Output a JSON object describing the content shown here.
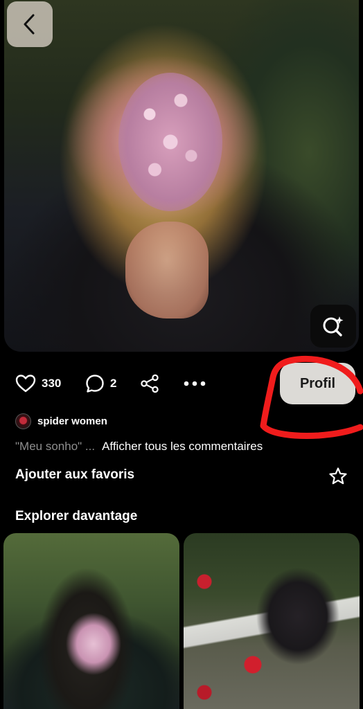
{
  "header": {
    "back_icon": "chevron-left-icon",
    "lens_icon": "visual-search-icon"
  },
  "actions": {
    "likes_count": "330",
    "comments_count": "2",
    "like_icon": "heart-icon",
    "comment_icon": "comment-icon",
    "share_icon": "share-icon",
    "more_icon": "more-icon"
  },
  "profile_button": {
    "label": "Profil"
  },
  "annotation": {
    "color": "#f01c1c"
  },
  "author": {
    "name": "spider women"
  },
  "comment_preview": {
    "snippet": "\"Meu sonho\" ...",
    "show_all": "Afficher tous les commentaires"
  },
  "favorites": {
    "label": "Ajouter aux favoris",
    "icon": "star-icon"
  },
  "explore": {
    "title": "Explorer davantage"
  }
}
